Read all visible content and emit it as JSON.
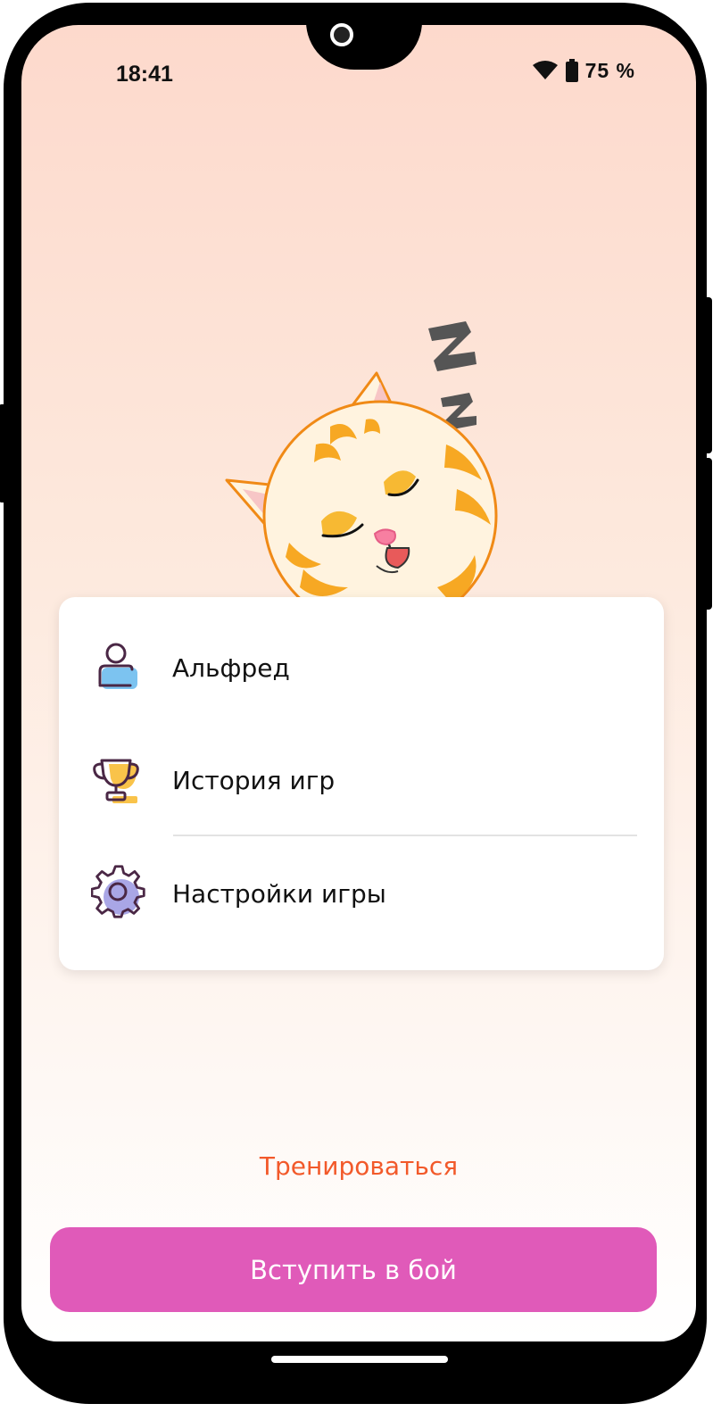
{
  "status_bar": {
    "time": "18:41",
    "battery": "75 %",
    "icons": [
      "wifi-icon",
      "battery-icon"
    ]
  },
  "illustration": {
    "name": "sleeping-cat"
  },
  "menu": {
    "items": [
      {
        "label": "Альфред",
        "icon": "user-icon"
      },
      {
        "label": "История игр",
        "icon": "trophy-icon"
      },
      {
        "label": "Настройки игры",
        "icon": "gear-icon"
      }
    ]
  },
  "actions": {
    "train_label": "Тренироваться",
    "fight_label": "Вступить в бой"
  },
  "colors": {
    "accent_orange": "#f2592a",
    "primary_button": "#e05ab9",
    "background_top": "#fdd9cc"
  }
}
